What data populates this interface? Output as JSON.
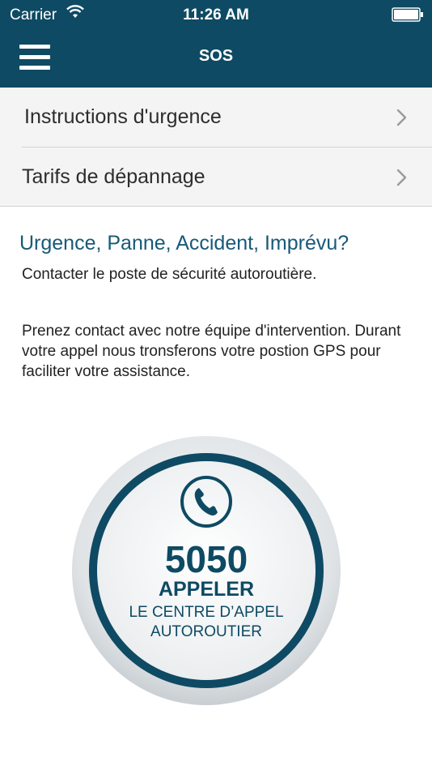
{
  "status_bar": {
    "carrier": "Carrier",
    "time": "11:26 AM"
  },
  "nav": {
    "title": "SOS",
    "menu_icon": "hamburger-menu-icon"
  },
  "menu_list": [
    {
      "label": "Instructions d'urgence"
    },
    {
      "label": "Tarifs de dépannage"
    }
  ],
  "content": {
    "headline": "Urgence, Panne, Accident, Imprévu?",
    "line1": "Contacter le poste de sécurité autoroutière.",
    "paragraph": "Prenez contact avec notre équipe d'intervention. Durant votre appel nous tronsferons votre postion GPS pour faciliter votre assistance."
  },
  "call_button": {
    "number": "5050",
    "action": "APPELER",
    "line1": "LE CENTRE D’APPEL",
    "line2": "AUTOROUTIER",
    "icon": "phone-icon"
  },
  "colors": {
    "header_bg": "#0e4a63",
    "accent": "#175a78",
    "list_bg": "#f4f4f4"
  }
}
